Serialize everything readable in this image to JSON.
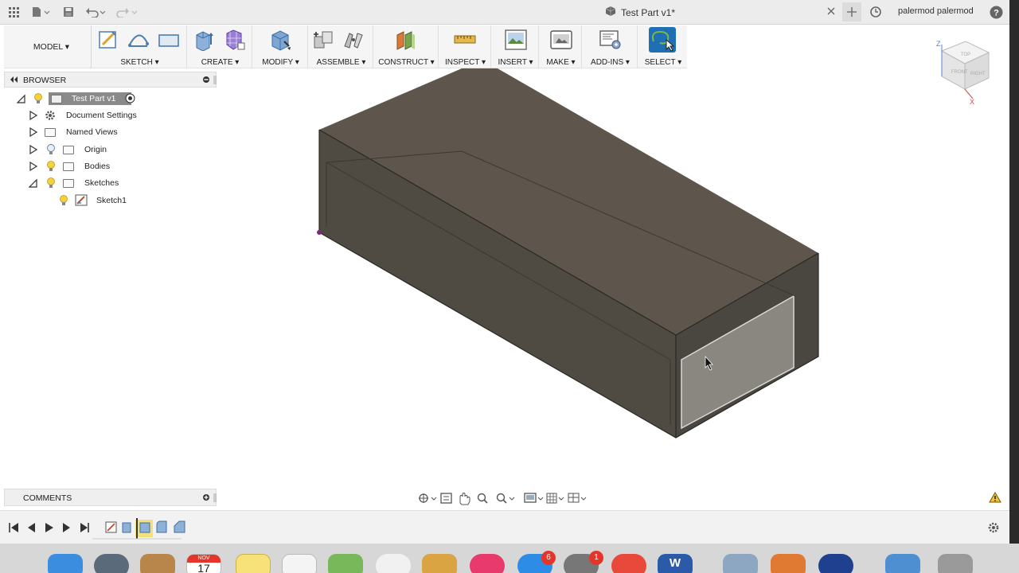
{
  "titlebar": {
    "doc_title": "Test Part v1*",
    "user": "palermod palermod",
    "icons": [
      "grid-icon",
      "file-icon",
      "save-icon",
      "undo-icon",
      "redo-icon",
      "close-icon",
      "plus-icon",
      "clock-icon",
      "help-icon"
    ]
  },
  "toolbar": {
    "workspace": "MODEL ▾",
    "groups": [
      {
        "label": "SKETCH ▾"
      },
      {
        "label": "CREATE ▾"
      },
      {
        "label": "MODIFY ▾"
      },
      {
        "label": "ASSEMBLE ▾"
      },
      {
        "label": "CONSTRUCT ▾"
      },
      {
        "label": "INSPECT ▾"
      },
      {
        "label": "INSERT ▾"
      },
      {
        "label": "MAKE ▾"
      },
      {
        "label": "ADD-INS ▾"
      },
      {
        "label": "SELECT ▾"
      }
    ]
  },
  "browser": {
    "title": "BROWSER",
    "items": [
      {
        "label": "Test Part v1"
      },
      {
        "label": "Document Settings"
      },
      {
        "label": "Named Views"
      },
      {
        "label": "Origin"
      },
      {
        "label": "Bodies"
      },
      {
        "label": "Sketches"
      },
      {
        "label": "Sketch1"
      }
    ]
  },
  "comments": {
    "title": "COMMENTS"
  },
  "viewcube": {
    "top": "TOP",
    "front": "FRONT",
    "right": "RIGHT",
    "axis_z": "Z",
    "axis_x": "X"
  },
  "dock": {
    "calendar_month": "NOV",
    "calendar_day": "17",
    "badges": {
      "appstore": "6",
      "settings": "1"
    },
    "word_letter": "W"
  },
  "colors": {
    "body_top": "#5e564c",
    "body_front": "#4f4a42",
    "body_right": "#4b4740",
    "accent": "#1e6fb3"
  }
}
